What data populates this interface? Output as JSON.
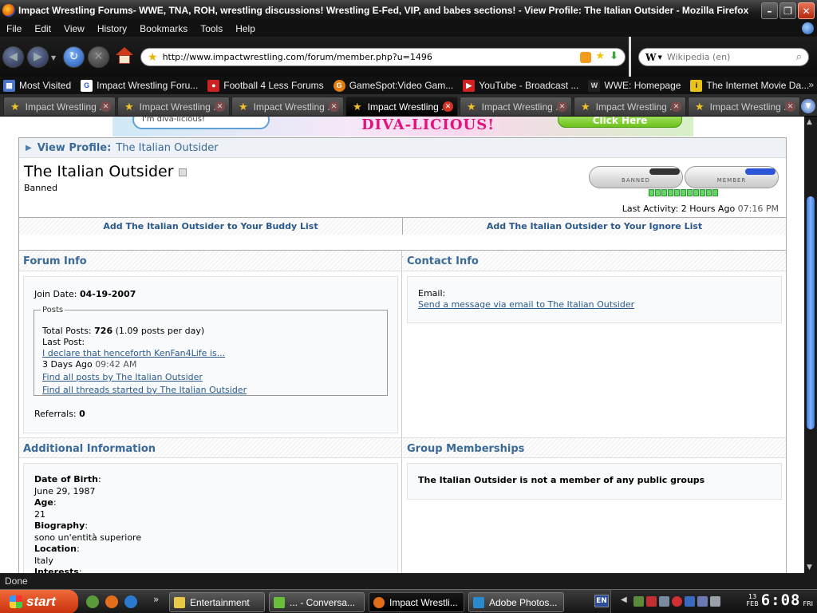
{
  "window": {
    "title": "Impact Wrestling Forums- WWE, TNA, ROH, wrestling discussions! Wrestling E-Fed, VIP, and babes sections! - View Profile: The Italian Outsider - Mozilla Firefox"
  },
  "menu": [
    "File",
    "Edit",
    "View",
    "History",
    "Bookmarks",
    "Tools",
    "Help"
  ],
  "navbar": {
    "url": "http://www.impactwrestling.com/forum/member.php?u=1496",
    "search_engine_letter": "W",
    "search_placeholder": "Wikipedia (en)"
  },
  "bookmarks": [
    {
      "label": "Most Visited",
      "icon": "most-visited-icon",
      "color": "#4a74c9"
    },
    {
      "label": "Impact Wrestling Foru...",
      "icon": "google-icon",
      "color": "#ffffff"
    },
    {
      "label": "Football 4 Less Forums",
      "icon": "football-icon",
      "color": "#cc2222"
    },
    {
      "label": "GameSpot:Video Gam...",
      "icon": "gamespot-icon",
      "color": "#e27d10"
    },
    {
      "label": "YouTube - Broadcast ...",
      "icon": "youtube-icon",
      "color": "#d42020"
    },
    {
      "label": "WWE: Homepage",
      "icon": "wwe-icon",
      "color": "#222222"
    },
    {
      "label": "The Internet Movie Da...",
      "icon": "imdb-icon",
      "color": "#e8c21a"
    }
  ],
  "tabs": [
    {
      "label": "Impact Wrestling ...",
      "active": false
    },
    {
      "label": "Impact Wrestling ...",
      "active": false
    },
    {
      "label": "Impact Wrestling ...",
      "active": false
    },
    {
      "label": "Impact Wrestling ...",
      "active": true
    },
    {
      "label": "Impact Wrestling ...",
      "active": false
    },
    {
      "label": "Impact Wrestling ...",
      "active": false
    },
    {
      "label": "Impact Wrestling ...",
      "active": false
    }
  ],
  "banner": {
    "bubble_text": "I'm diva-licious!",
    "headline": "DIVA-LICIOUS!",
    "button": "Click Here"
  },
  "profile": {
    "header_label": "View Profile:",
    "header_name": "The Italian Outsider",
    "username": "The Italian Outsider",
    "usertitle": "Banned",
    "rank_banned": "BANNED",
    "rank_member": "MEMBER",
    "reputation_pips": 11,
    "last_activity_label": "Last Activity: 2 Hours Ago",
    "last_activity_time": "07:16 PM",
    "buddy_link": "Add The Italian Outsider to Your Buddy List",
    "ignore_link": "Add The Italian Outsider to Your Ignore List"
  },
  "forum_info": {
    "heading": "Forum Info",
    "join_label": "Join Date:",
    "join_date": "04-19-2007",
    "posts_legend": "Posts",
    "total_posts_label": "Total Posts:",
    "total_posts": "726",
    "posts_per_day": "(1.09 posts per day)",
    "last_post_label": "Last Post:",
    "last_post_title": "I declare that henceforth KenFan4Life is...",
    "last_post_date": "3 Days Ago",
    "last_post_time": "09:42 AM",
    "find_posts": "Find all posts by The Italian Outsider",
    "find_threads": "Find all threads started by The Italian Outsider",
    "referrals_label": "Referrals:",
    "referrals": "0"
  },
  "contact_info": {
    "heading": "Contact Info",
    "email_label": "Email:",
    "email_link": "Send a message via email to The Italian Outsider"
  },
  "additional_info": {
    "heading": "Additional Information",
    "dob_label": "Date of Birth",
    "dob": "June 29, 1987",
    "age_label": "Age",
    "age": "21",
    "bio_label": "Biography",
    "bio": "sono un'entità superiore",
    "location_label": "Location",
    "location": "Italy",
    "interests_label": "Interests"
  },
  "groups": {
    "heading": "Group Memberships",
    "text": "The Italian Outsider is not a member of any public groups"
  },
  "status": "Done",
  "taskbar": {
    "start": "start",
    "tasks": [
      {
        "label": "Entertainment",
        "icon_color": "#e8c84a",
        "active": false
      },
      {
        "label": "... - Conversa...",
        "icon_color": "#6abf3a",
        "active": false
      },
      {
        "label": "Impact Wrestli...",
        "icon_color": "#e26d1a",
        "active": true
      },
      {
        "label": "Adobe Photos...",
        "icon_color": "#2a8ad0",
        "active": false
      }
    ],
    "language": "EN",
    "clock_day": "13",
    "clock_month": "FEB",
    "clock_time": "6:08",
    "clock_weekday": "FRI"
  }
}
